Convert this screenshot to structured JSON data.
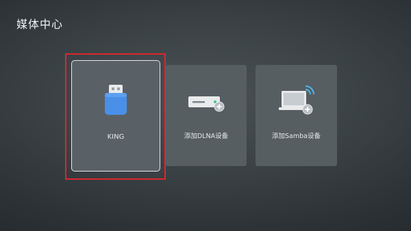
{
  "header": {
    "title": "媒体中心"
  },
  "devices": [
    {
      "label": "KING",
      "icon": "usb-drive-icon",
      "focused": true
    },
    {
      "label": "添加DLNA设备",
      "icon": "dlna-device-add-icon",
      "focused": false
    },
    {
      "label": "添加Samba设备",
      "icon": "samba-laptop-add-icon",
      "focused": false
    }
  ],
  "colors": {
    "focus_border": "#e0262b",
    "usb_blue": "#4a90e8",
    "tile_bg": "#565e62"
  }
}
